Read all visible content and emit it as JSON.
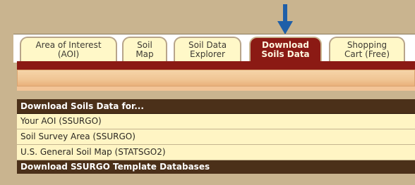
{
  "tabs": [
    {
      "line1": "Area of Interest",
      "line2": "(AOI)"
    },
    {
      "line1": "Soil",
      "line2": "Map"
    },
    {
      "line1": "Soil Data",
      "line2": "Explorer"
    },
    {
      "line1": "Download",
      "line2": "Soils Data"
    },
    {
      "line1": "Shopping",
      "line2": "Cart (Free)"
    }
  ],
  "active_tab": "Download Soils Data",
  "colors": {
    "active_tab": "#8b1a14",
    "header": "#4b3019",
    "row": "#fff5c4",
    "arrow": "#1f5fa8"
  },
  "icons": {
    "pointer": "down-arrow-icon"
  },
  "download_section": {
    "header": "Download Soils Data for...",
    "items": [
      "Your AOI (SSURGO)",
      "Soil Survey Area (SSURGO)",
      "U.S. General Soil Map (STATSGO2)"
    ]
  },
  "template_section": {
    "header": "Download SSURGO Template Databases"
  }
}
